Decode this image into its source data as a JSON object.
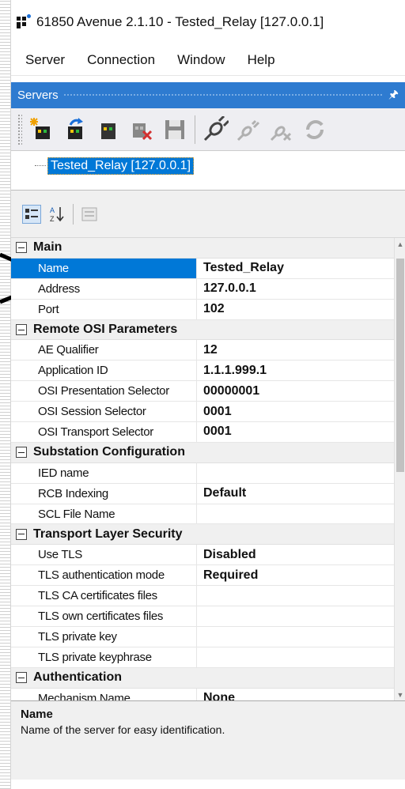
{
  "window": {
    "title": "61850 Avenue 2.1.10 - Tested_Relay [127.0.0.1]"
  },
  "menu": [
    "Server",
    "Connection",
    "Window",
    "Help"
  ],
  "panel": {
    "title": "Servers"
  },
  "toolbar": {
    "icons": [
      "new-server-icon",
      "edit-server-icon",
      "delete-server-icon",
      "save-icon",
      "connect-icon",
      "connect-all-icon",
      "disconnect-icon",
      "refresh-icon"
    ]
  },
  "tree": {
    "selected_node": "Tested_Relay [127.0.0.1]"
  },
  "property_grid": {
    "categories": [
      {
        "name": "Main",
        "rows": [
          {
            "name": "Name",
            "value": "Tested_Relay"
          },
          {
            "name": "Address",
            "value": "127.0.0.1"
          },
          {
            "name": "Port",
            "value": "102"
          }
        ]
      },
      {
        "name": "Remote OSI Parameters",
        "rows": [
          {
            "name": "AE Qualifier",
            "value": "12"
          },
          {
            "name": "Application ID",
            "value": "1.1.1.999.1"
          },
          {
            "name": "OSI Presentation Selector",
            "value": "00000001"
          },
          {
            "name": "OSI Session Selector",
            "value": "0001"
          },
          {
            "name": "OSI Transport Selector",
            "value": "0001"
          }
        ]
      },
      {
        "name": "Substation Configuration",
        "rows": [
          {
            "name": "IED name",
            "value": ""
          },
          {
            "name": "RCB Indexing",
            "value": "Default"
          },
          {
            "name": "SCL File Name",
            "value": ""
          }
        ]
      },
      {
        "name": "Transport Layer Security",
        "rows": [
          {
            "name": "Use TLS",
            "value": "Disabled"
          },
          {
            "name": "TLS authentication mode",
            "value": "Required"
          },
          {
            "name": "TLS CA certificates files",
            "value": ""
          },
          {
            "name": "TLS own certificates files",
            "value": ""
          },
          {
            "name": "TLS private key",
            "value": ""
          },
          {
            "name": "TLS private keyphrase",
            "value": ""
          }
        ]
      },
      {
        "name": "Authentication",
        "rows": [
          {
            "name": "Mechanism Name",
            "value": "None"
          }
        ]
      }
    ],
    "selected": "Name"
  },
  "description": {
    "title": "Name",
    "text": "Name of the server for easy identification."
  }
}
